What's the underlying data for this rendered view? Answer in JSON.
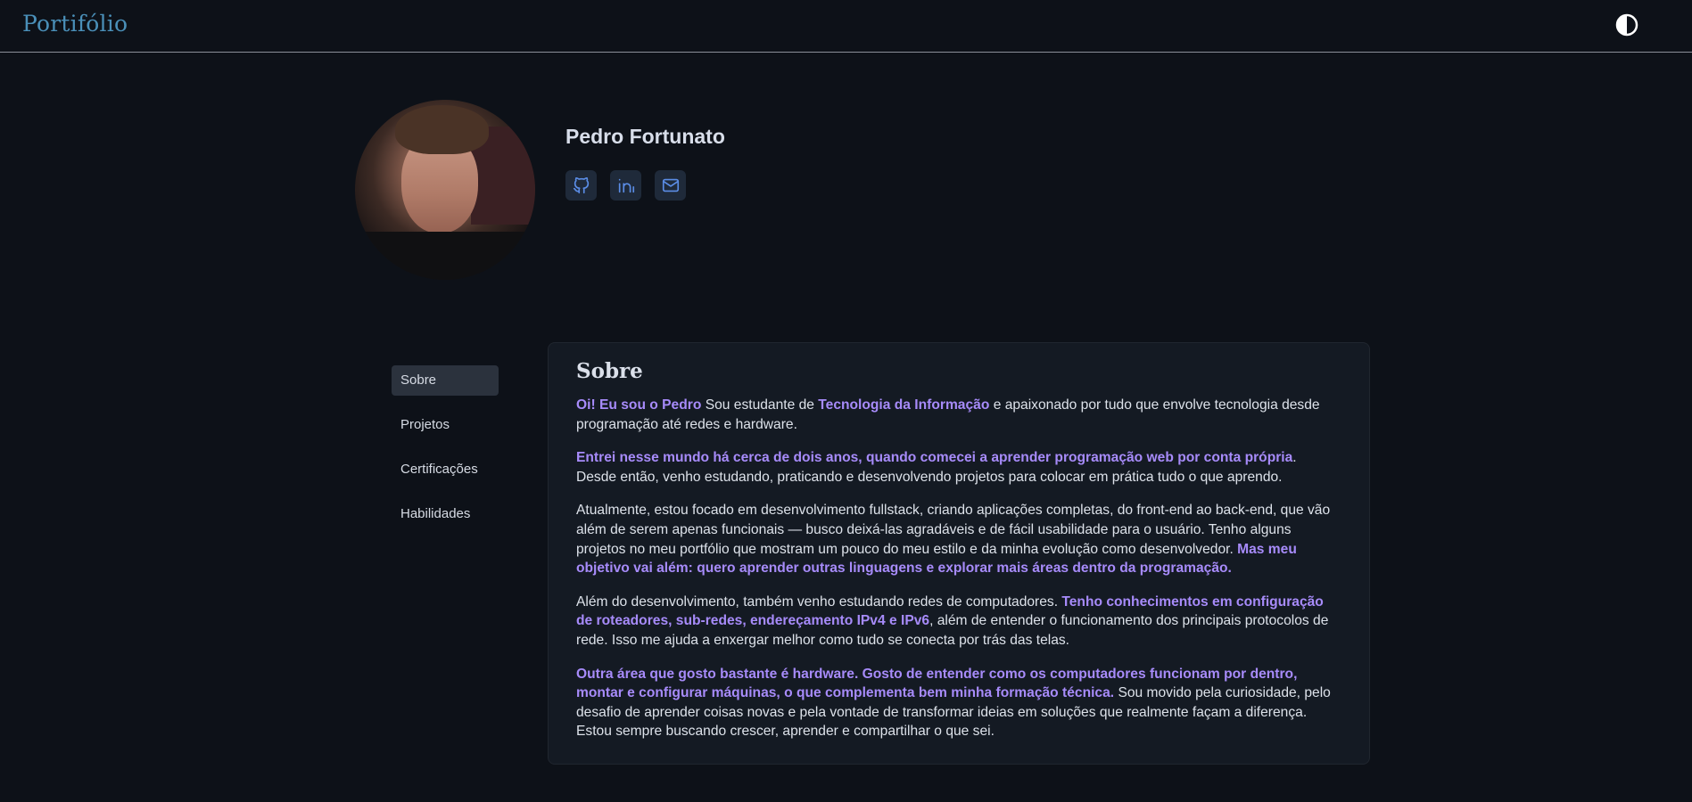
{
  "header": {
    "brand": "Portifólio",
    "theme_toggle_icon": "contrast-icon"
  },
  "profile": {
    "name": "Pedro Fortunato",
    "avatar_icon": "profile-photo",
    "socials": [
      {
        "icon": "github-icon"
      },
      {
        "icon": "linkedin-icon"
      },
      {
        "icon": "mail-icon"
      }
    ]
  },
  "nav": {
    "items": [
      "Sobre",
      "Projetos",
      "Certificações",
      "Habilidades"
    ],
    "active": "Sobre"
  },
  "about": {
    "title": "Sobre",
    "p1": {
      "hl1": "Oi! Eu sou o Pedro",
      "t1": " Sou estudante de ",
      "hl2": "Tecnologia da Informação",
      "t2": " e apaixonado por tudo que envolve tecnologia desde programação até redes e hardware."
    },
    "p2": {
      "hl1": "Entrei nesse mundo há cerca de dois anos, quando comecei a aprender programação web por conta própria",
      "t1": ". Desde então, venho estudando, praticando e desenvolvendo projetos para colocar em prática tudo o que aprendo."
    },
    "p3": {
      "t1": "Atualmente, estou focado em desenvolvimento fullstack, criando aplicações completas, do front-end ao back-end, que vão além de serem apenas funcionais — busco deixá-las agradáveis e de fácil usabilidade para o usuário. Tenho alguns projetos no meu portfólio que mostram um pouco do meu estilo e da minha evolução como desenvolvedor. ",
      "hl1": "Mas meu objetivo vai além: quero aprender outras linguagens e explorar mais áreas dentro da programação."
    },
    "p4": {
      "t1": "Além do desenvolvimento, também venho estudando redes de computadores. ",
      "hl1": "Tenho conhecimentos em configuração de roteadores, sub-redes, endereçamento IPv4 e IPv6",
      "t2": ", além de entender o funcionamento dos principais protocolos de rede. Isso me ajuda a enxergar melhor como tudo se conecta por trás das telas."
    },
    "p5": {
      "hl1": "Outra área que gosto bastante é hardware. Gosto de entender como os computadores funcionam por dentro, montar e configurar máquinas, o que complementa bem minha formação técnica.",
      "t1": " Sou movido pela curiosidade, pelo desafio de aprender coisas novas e pela vontade de transformar ideias em soluções que realmente façam a diferença. Estou sempre buscando crescer, aprender e compartilhar o que sei."
    }
  },
  "colors": {
    "background": "#0d1118",
    "brand": "#4a8fb8",
    "highlight": "#a78bfa",
    "card": "#141a23"
  }
}
